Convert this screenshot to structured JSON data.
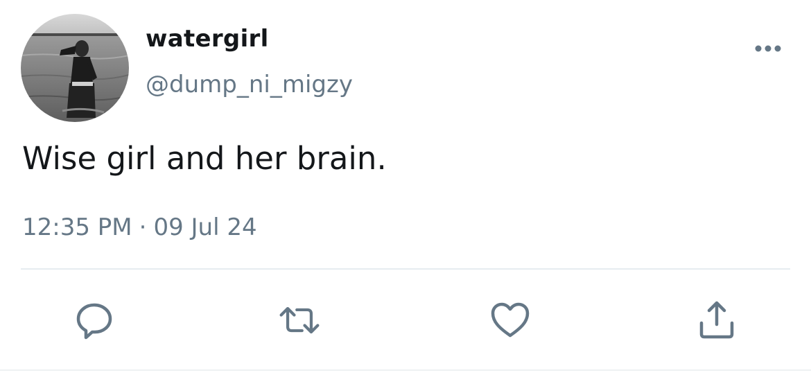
{
  "tweet": {
    "author": {
      "display_name": "watergirl",
      "handle": "@dump_ni_migzy",
      "avatar_icon": "profile-photo"
    },
    "text": "Wise girl and her brain.",
    "time": "12:35 PM",
    "separator": "·",
    "date": "09 Jul 24",
    "menu_icon": "more-horizontal-icon",
    "actions": [
      {
        "name": "reply",
        "icon": "reply-icon"
      },
      {
        "name": "retweet",
        "icon": "retweet-icon"
      },
      {
        "name": "like",
        "icon": "heart-icon"
      },
      {
        "name": "share",
        "icon": "share-icon"
      }
    ]
  },
  "colors": {
    "text_primary": "#14171a",
    "text_secondary": "#657786",
    "icon": "#657786",
    "divider": "#e6ecf0"
  }
}
